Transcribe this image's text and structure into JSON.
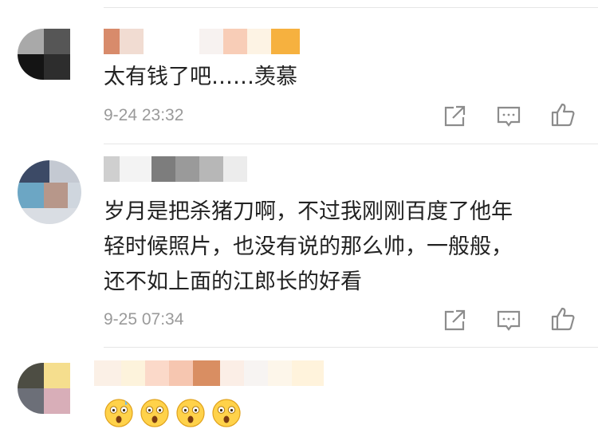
{
  "comments": [
    {
      "text": "太有钱了吧……羡慕",
      "time": "9-24 23:32",
      "actions": [
        "share-icon",
        "reply-icon",
        "like-icon"
      ]
    },
    {
      "text_lines": [
        "岁月是把杀猪刀啊，不过我刚刚百度了他年",
        "轻时候照片，也没有说的那么帅，一般般，",
        "还不如上面的江郎长的好看"
      ],
      "time": "9-25 07:34",
      "actions": [
        "share-icon",
        "reply-icon",
        "like-icon"
      ]
    },
    {
      "emojis": [
        "astonished-face",
        "astonished-face",
        "astonished-face",
        "astonished-face"
      ]
    }
  ],
  "colors": {
    "text": "#222222",
    "meta": "#9a9a9a",
    "icon": "#8c8c8c",
    "divider": "#e6e6e6"
  }
}
